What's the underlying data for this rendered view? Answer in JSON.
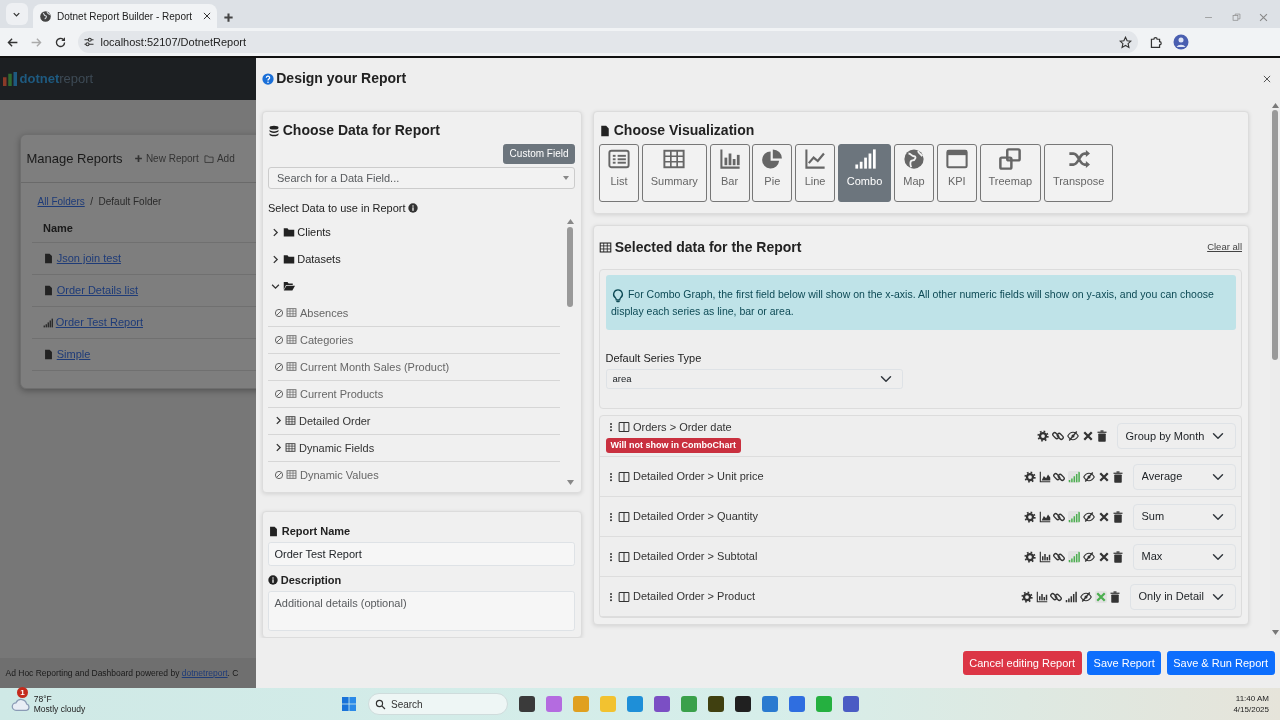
{
  "browser": {
    "tab_title": "Dotnet Report Builder - Report",
    "address": "localhost:52107/DotnetReport"
  },
  "app": {
    "logo_bold": "dotnet",
    "logo_light": "report",
    "card_title": "Manage Reports",
    "actions": [
      {
        "label": "New Report",
        "kind": "plus"
      },
      {
        "label": "Add",
        "kind": "folder"
      }
    ],
    "breadcrumb": [
      {
        "label": "All Folders",
        "link": true
      },
      {
        "label": "Default Folder",
        "link": false
      }
    ],
    "breadcrumb_separator": "/",
    "column": "Name",
    "reports": [
      {
        "label": "Json join test",
        "kind": "document"
      },
      {
        "label": "Order Details list",
        "kind": "document"
      },
      {
        "label": "Order Test Report",
        "kind": "chart"
      },
      {
        "label": "Simple",
        "kind": "document"
      }
    ],
    "footer": "Ad Hoc Reporting and Dashboard powered by",
    "footer_link": "dotnetreport",
    "footer_tail": ". C"
  },
  "modal": {
    "title": "Design your Report"
  },
  "data_panel": {
    "title": "Choose Data for Report",
    "custom_field": "Custom Field",
    "search_placeholder": "Search for a Data Field...",
    "select_label": "Select Data to use in Report",
    "tree": [
      {
        "label": "Clients",
        "expanded": false
      },
      {
        "label": "Datasets",
        "expanded": false
      },
      {
        "expanded": true,
        "children": [
          {
            "label": "Absences",
            "has_fields": false
          },
          {
            "label": "Categories",
            "has_fields": false
          },
          {
            "label": "Current Month Sales (Product)",
            "has_fields": false
          },
          {
            "label": "Current Products",
            "has_fields": false
          },
          {
            "label": "Detailed Order",
            "has_fields": true
          },
          {
            "label": "Dynamic Fields",
            "has_fields": true
          },
          {
            "label": "Dynamic Values",
            "has_fields": false
          }
        ]
      }
    ]
  },
  "report_panel": {
    "name_label": "Report Name",
    "name_value": "Order Test Report",
    "description_label": "Description",
    "description_placeholder": "Additional details (optional)"
  },
  "visualization": {
    "title": "Choose Visualization",
    "types": [
      {
        "label": "List",
        "selected": false
      },
      {
        "label": "Summary",
        "selected": false
      },
      {
        "label": "Bar",
        "selected": false
      },
      {
        "label": "Pie",
        "selected": false
      },
      {
        "label": "Line",
        "selected": false
      },
      {
        "label": "Combo",
        "selected": true
      },
      {
        "label": "Map",
        "selected": false
      },
      {
        "label": "KPI",
        "selected": false
      },
      {
        "label": "Treemap",
        "selected": false
      },
      {
        "label": "Transpose",
        "selected": false
      }
    ]
  },
  "selected": {
    "title": "Selected data for the Report",
    "clear": "Clear all",
    "hint": "For Combo Graph, the first field below will show on the x-axis. All other numeric fields will show on y-axis, and you can choose display each series as line, bar or area.",
    "series_label": "Default Series Type",
    "series_value": "area",
    "fields": [
      {
        "label": "Orders > Order date",
        "badge": "Will not show in ComboChart",
        "icons": [
          {
            "kind": "gear",
            "on": false
          },
          {
            "kind": "link",
            "on": false
          },
          {
            "kind": "hidden",
            "on": false
          },
          {
            "kind": "remove",
            "on": false
          },
          {
            "kind": "trash",
            "on": false
          }
        ],
        "aggregate": "Group by Month"
      },
      {
        "label": "Detailed Order > Unit price",
        "icons": [
          {
            "kind": "gear",
            "on": false
          },
          {
            "kind": "area",
            "on": false
          },
          {
            "kind": "link",
            "on": false
          },
          {
            "kind": "combo",
            "on": true
          },
          {
            "kind": "hidden",
            "on": false
          },
          {
            "kind": "remove",
            "on": false
          },
          {
            "kind": "trash",
            "on": false
          }
        ],
        "aggregate": "Average"
      },
      {
        "label": "Detailed Order > Quantity",
        "icons": [
          {
            "kind": "gear",
            "on": false
          },
          {
            "kind": "area",
            "on": false
          },
          {
            "kind": "link",
            "on": false
          },
          {
            "kind": "combo",
            "on": true
          },
          {
            "kind": "hidden",
            "on": false
          },
          {
            "kind": "remove",
            "on": false
          },
          {
            "kind": "trash",
            "on": false
          }
        ],
        "aggregate": "Sum"
      },
      {
        "label": "Detailed Order > Subtotal",
        "icons": [
          {
            "kind": "gear",
            "on": false
          },
          {
            "kind": "bar",
            "on": false
          },
          {
            "kind": "link",
            "on": false
          },
          {
            "kind": "combo",
            "on": true
          },
          {
            "kind": "hidden",
            "on": false
          },
          {
            "kind": "remove",
            "on": false
          },
          {
            "kind": "trash",
            "on": false
          }
        ],
        "aggregate": "Max"
      },
      {
        "label": "Detailed Order > Product",
        "icons": [
          {
            "kind": "gear",
            "on": false
          },
          {
            "kind": "bar",
            "on": false
          },
          {
            "kind": "link",
            "on": false
          },
          {
            "kind": "combo",
            "on": false
          },
          {
            "kind": "hidden",
            "on": false
          },
          {
            "kind": "remove",
            "on": true
          },
          {
            "kind": "trash",
            "on": false
          }
        ],
        "aggregate": "Only in Detail"
      }
    ]
  },
  "footer_buttons": [
    {
      "label": "Cancel editing Report",
      "kind": "danger"
    },
    {
      "label": "Save Report",
      "kind": "primary"
    },
    {
      "label": "Save & Run Report",
      "kind": "primary"
    }
  ],
  "taskbar": {
    "weather_badge": "1",
    "temperature": "78°F",
    "weather": "Mostly cloudy",
    "search": "Search",
    "apps": [
      {
        "color": "#3a3a3a"
      },
      {
        "color": "#b46be0"
      },
      {
        "color": "#e0a020"
      },
      {
        "color": "#f2c230"
      },
      {
        "color": "#1e8fd8"
      },
      {
        "color": "#7b4fc4"
      },
      {
        "color": "#3aa04a"
      },
      {
        "color": "#404010"
      },
      {
        "color": "#202020"
      },
      {
        "color": "#2a7ad0"
      },
      {
        "color": "#2f6ee0"
      },
      {
        "color": "#25b040"
      },
      {
        "color": "#4b5cc4"
      }
    ],
    "time": "11:40 AM",
    "date": "4/15/2025"
  }
}
